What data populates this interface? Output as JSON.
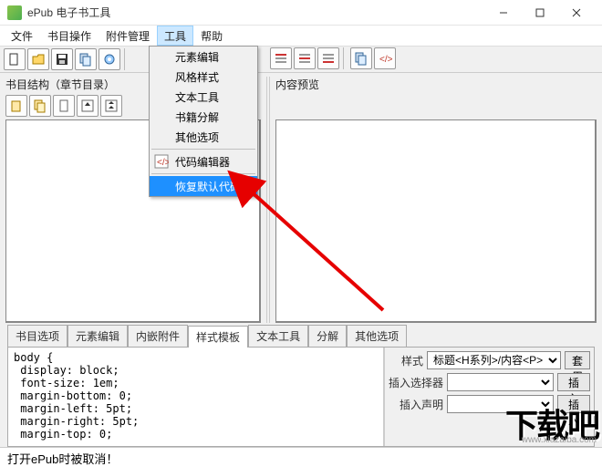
{
  "title": "ePub 电子书工具",
  "menu": {
    "file": "文件",
    "book": "书目操作",
    "attach": "附件管理",
    "tools": "工具",
    "help": "帮助"
  },
  "dropdown": {
    "i0": "元素编辑",
    "i1": "风格样式",
    "i2": "文本工具",
    "i3": "书籍分解",
    "i4": "其他选项",
    "i5": "代码编辑器",
    "i6": "恢复默认代码"
  },
  "left_panel_label": "书目结构（章节目录）",
  "right_panel_label": "内容预览",
  "tabs": {
    "t0": "书目选项",
    "t1": "元素编辑",
    "t2": "内嵌附件",
    "t3": "样式模板",
    "t4": "文本工具",
    "t5": "分解",
    "t6": "其他选项"
  },
  "code": "body {\n display: block;\n font-size: 1em;\n margin-bottom: 0;\n margin-left: 5pt;\n margin-right: 5pt;\n margin-top: 0;",
  "props": {
    "style_label": "样式",
    "style_value": "标题<H系列>/内容<P>",
    "apply_btn": "套用",
    "sel_label": "插入选择器",
    "sel_btn": "插入",
    "decl_label": "插入声明",
    "decl_btn": "插入"
  },
  "status": "打开ePub时被取消！",
  "watermark": "www.xiazaiba.com",
  "biglogo": "下载吧"
}
